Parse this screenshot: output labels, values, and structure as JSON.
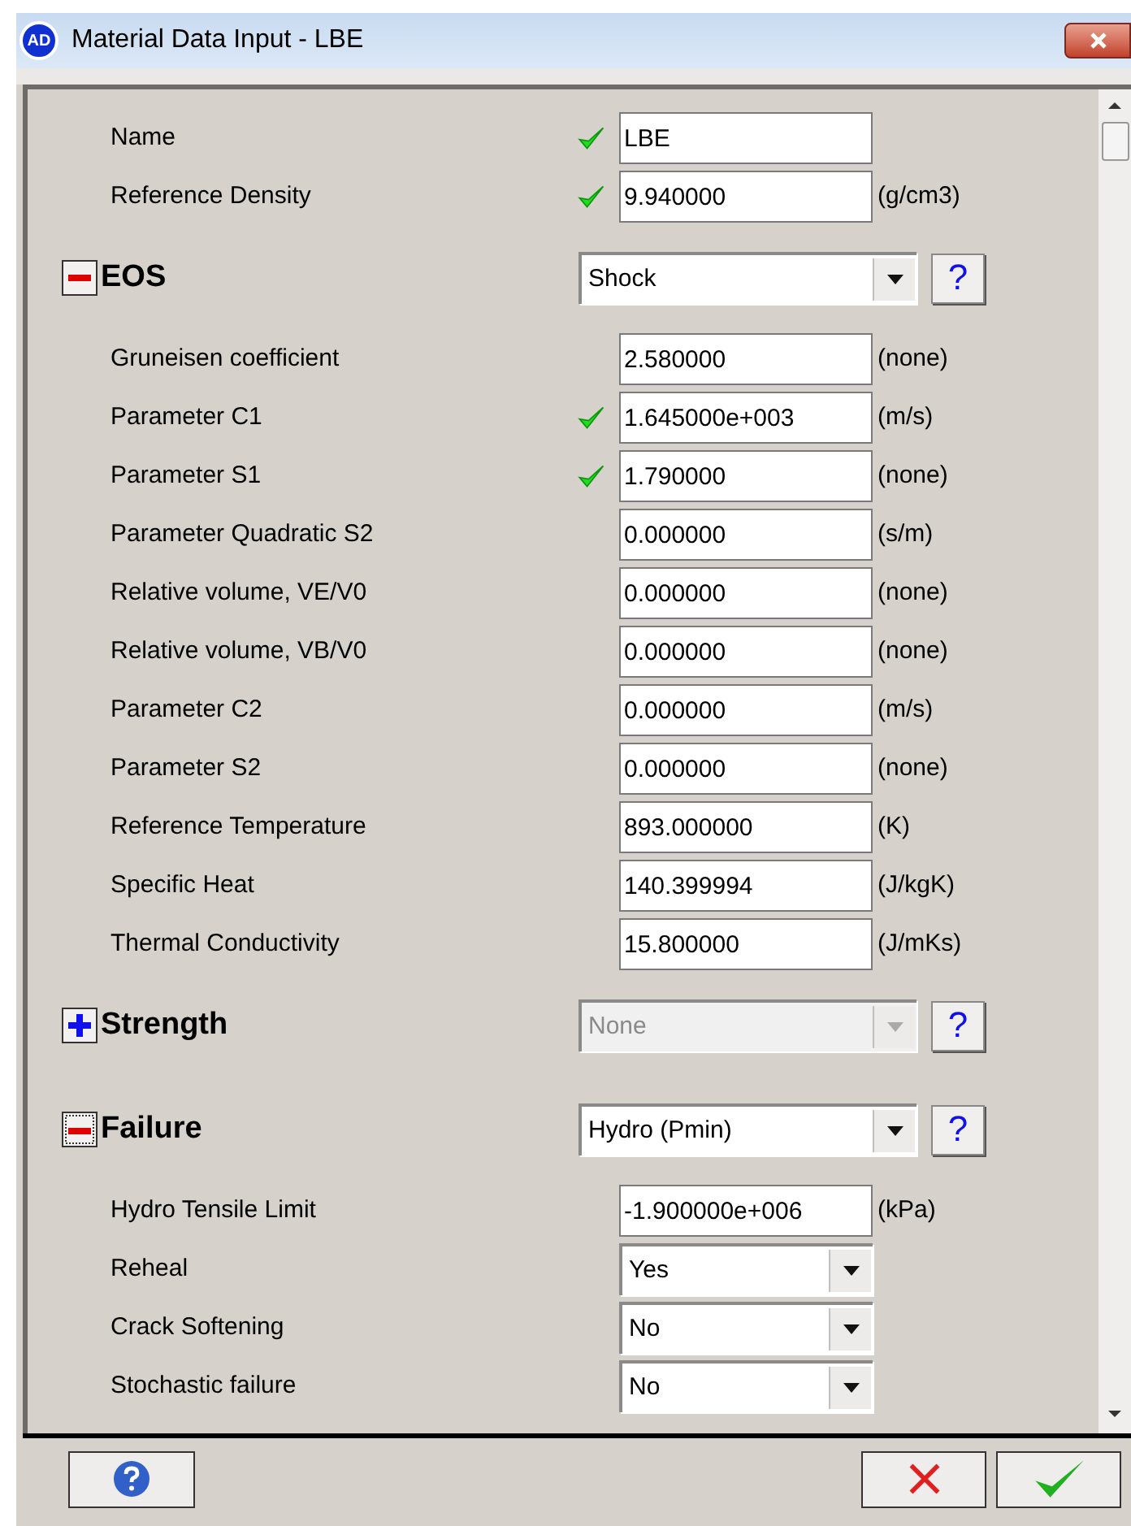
{
  "window": {
    "title": "Material Data Input - LBE",
    "logo": "AD"
  },
  "top_fields": [
    {
      "label": "Name",
      "value": "LBE",
      "validated": true
    },
    {
      "label": "Reference Density",
      "value": "9.940000",
      "unit": "(g/cm3)",
      "validated": true
    }
  ],
  "sections": [
    {
      "title": "EOS",
      "expanded": true,
      "focused": false,
      "selector": {
        "value": "Shock",
        "disabled": false
      },
      "help": "?",
      "fields": [
        {
          "kind": "text",
          "label": "Gruneisen coefficient",
          "value": "2.580000",
          "unit": "(none)",
          "validated": false
        },
        {
          "kind": "text",
          "label": "Parameter C1",
          "value": "1.645000e+003",
          "unit": "(m/s)",
          "validated": true
        },
        {
          "kind": "text",
          "label": "Parameter S1",
          "value": "1.790000",
          "unit": "(none)",
          "validated": true
        },
        {
          "kind": "text",
          "label": "Parameter Quadratic S2",
          "value": "0.000000",
          "unit": "(s/m)",
          "validated": false
        },
        {
          "kind": "text",
          "label": "Relative volume, VE/V0",
          "value": "0.000000",
          "unit": "(none)",
          "validated": false
        },
        {
          "kind": "text",
          "label": "Relative volume, VB/V0",
          "value": "0.000000",
          "unit": "(none)",
          "validated": false
        },
        {
          "kind": "text",
          "label": "Parameter C2",
          "value": "0.000000",
          "unit": "(m/s)",
          "validated": false
        },
        {
          "kind": "text",
          "label": "Parameter S2",
          "value": "0.000000",
          "unit": "(none)",
          "validated": false
        },
        {
          "kind": "text",
          "label": "Reference Temperature",
          "value": "893.000000",
          "unit": "(K)",
          "validated": false
        },
        {
          "kind": "text",
          "label": "Specific Heat",
          "value": "140.399994",
          "unit": "(J/kgK)",
          "validated": false
        },
        {
          "kind": "text",
          "label": "Thermal Conductivity",
          "value": "15.800000",
          "unit": "(J/mKs)",
          "validated": false
        }
      ]
    },
    {
      "title": "Strength",
      "expanded": false,
      "focused": false,
      "selector": {
        "value": "None",
        "disabled": true
      },
      "help": "?"
    },
    {
      "title": "Failure",
      "expanded": true,
      "focused": true,
      "selector": {
        "value": "Hydro (Pmin)",
        "disabled": false
      },
      "help": "?",
      "fields": [
        {
          "kind": "text",
          "label": "Hydro Tensile Limit",
          "value": "-1.900000e+006",
          "unit": "(kPa)",
          "validated": false
        },
        {
          "kind": "select",
          "label": "Reheal",
          "value": "Yes"
        },
        {
          "kind": "select",
          "label": "Crack Softening",
          "value": "No"
        },
        {
          "kind": "select",
          "label": "Stochastic failure",
          "value": "No"
        }
      ]
    }
  ]
}
